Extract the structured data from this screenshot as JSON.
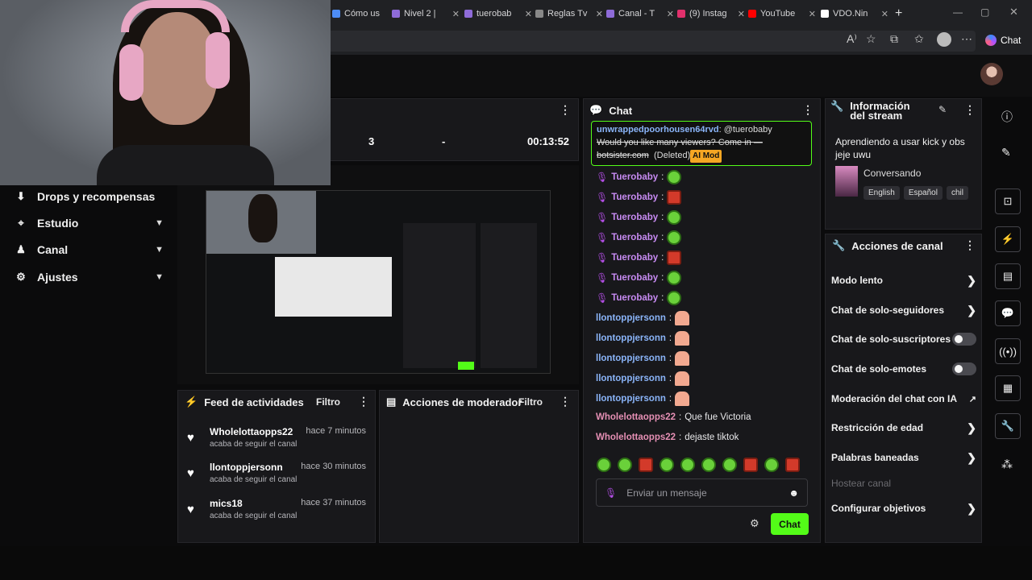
{
  "browser": {
    "tabs": [
      {
        "label": "Cómo us",
        "color": "#4d8cf5"
      },
      {
        "label": "Nivel 2 |",
        "color": "#8e6bd8"
      },
      {
        "label": "tuerobab",
        "color": "#8e6bd8"
      },
      {
        "label": "Reglas Tv",
        "color": "#888888"
      },
      {
        "label": "Canal - T",
        "color": "#8e6bd8"
      },
      {
        "label": "(9) Instag",
        "color": "#e1306c"
      },
      {
        "label": "YouTube",
        "color": "#ff0000"
      },
      {
        "label": "VDO.Nin",
        "color": "#ffffff"
      }
    ],
    "new_tab": "+",
    "copilot_label": "Chat"
  },
  "sidebar": {
    "items": [
      {
        "label": "Drops y recompensas",
        "icon": "gift-icon",
        "has_chevron": false
      },
      {
        "label": "Estudio",
        "icon": "studio-icon",
        "has_chevron": true
      },
      {
        "label": "Canal",
        "icon": "users-icon",
        "has_chevron": true
      },
      {
        "label": "Ajustes",
        "icon": "gear-icon",
        "has_chevron": true
      }
    ]
  },
  "stats": {
    "values": [
      "3",
      "-",
      "00:13:52"
    ]
  },
  "feed": {
    "title": "Feed de actividades",
    "filter": "Filtro",
    "items": [
      {
        "name": "Wholelottaopps22",
        "time": "hace 7 minutos",
        "action": "acaba de seguir el canal"
      },
      {
        "name": "llontoppjersonn",
        "time": "hace 30 minutos",
        "action": "acaba de seguir el canal"
      },
      {
        "name": "mics18",
        "time": "hace 37 minutos",
        "action": "acaba de seguir el canal"
      }
    ]
  },
  "mod_actions": {
    "title": "Acciones de moderador",
    "filter": "Filtro"
  },
  "chat": {
    "title": "Chat",
    "pinned": {
      "user": "unwrappedpoorhousen64rvd",
      "mention": "@tuerobaby",
      "text": "Would you like many viewers? Come in — botsister.com",
      "deleted": "(Deleted)",
      "badge": "AI Mod"
    },
    "messages": [
      {
        "user": "Tuerobaby",
        "color": "#c78bf2",
        "emote": "e-green",
        "mic": true,
        "text": ""
      },
      {
        "user": "Tuerobaby",
        "color": "#c78bf2",
        "emote": "e-red",
        "mic": true,
        "text": ""
      },
      {
        "user": "Tuerobaby",
        "color": "#c78bf2",
        "emote": "e-green",
        "mic": true,
        "text": ""
      },
      {
        "user": "Tuerobaby",
        "color": "#c78bf2",
        "emote": "e-green",
        "mic": true,
        "text": ""
      },
      {
        "user": "Tuerobaby",
        "color": "#c78bf2",
        "emote": "e-red",
        "mic": true,
        "text": ""
      },
      {
        "user": "Tuerobaby",
        "color": "#c78bf2",
        "emote": "e-green",
        "mic": true,
        "text": ""
      },
      {
        "user": "Tuerobaby",
        "color": "#c78bf2",
        "emote": "e-green",
        "mic": true,
        "text": ""
      },
      {
        "user": "llontoppjersonn",
        "color": "#8ab4f8",
        "emote": "e-pat",
        "mic": false,
        "text": ""
      },
      {
        "user": "llontoppjersonn",
        "color": "#8ab4f8",
        "emote": "e-pat",
        "mic": false,
        "text": ""
      },
      {
        "user": "llontoppjersonn",
        "color": "#8ab4f8",
        "emote": "e-pat",
        "mic": false,
        "text": ""
      },
      {
        "user": "llontoppjersonn",
        "color": "#8ab4f8",
        "emote": "e-pat",
        "mic": false,
        "text": ""
      },
      {
        "user": "llontoppjersonn",
        "color": "#8ab4f8",
        "emote": "e-pat",
        "mic": false,
        "text": ""
      },
      {
        "user": "Wholelottaopps22",
        "color": "#e58fb4",
        "emote": "",
        "mic": false,
        "text": "Que fue Victoria"
      },
      {
        "user": "Wholelottaopps22",
        "color": "#e58fb4",
        "emote": "",
        "mic": false,
        "text": "dejaste tiktok"
      }
    ],
    "placeholder": "Enviar un mensaje",
    "send_label": "Chat"
  },
  "info": {
    "title": "Información del stream",
    "stream_title": "Aprendiendo a usar kick y obs jeje uwu",
    "category": "Conversando",
    "tags": [
      "English",
      "Español",
      "chil"
    ]
  },
  "actions": {
    "title": "Acciones de canal",
    "items": [
      {
        "label": "Modo lento",
        "kind": "chevron"
      },
      {
        "label": "Chat de solo-seguidores",
        "kind": "chevron"
      },
      {
        "label": "Chat de solo-suscriptores",
        "kind": "toggle"
      },
      {
        "label": "Chat de solo-emotes",
        "kind": "toggle"
      },
      {
        "label": "Moderación del chat con IA",
        "kind": "external"
      },
      {
        "label": "Restricción de edad",
        "kind": "chevron"
      },
      {
        "label": "Palabras baneadas",
        "kind": "chevron"
      },
      {
        "label": "Hostear canal",
        "kind": "disabled"
      },
      {
        "label": "Configurar objetivos",
        "kind": "chevron"
      }
    ]
  },
  "colors": {
    "accent": "#53fc18",
    "panel": "#18181b"
  }
}
